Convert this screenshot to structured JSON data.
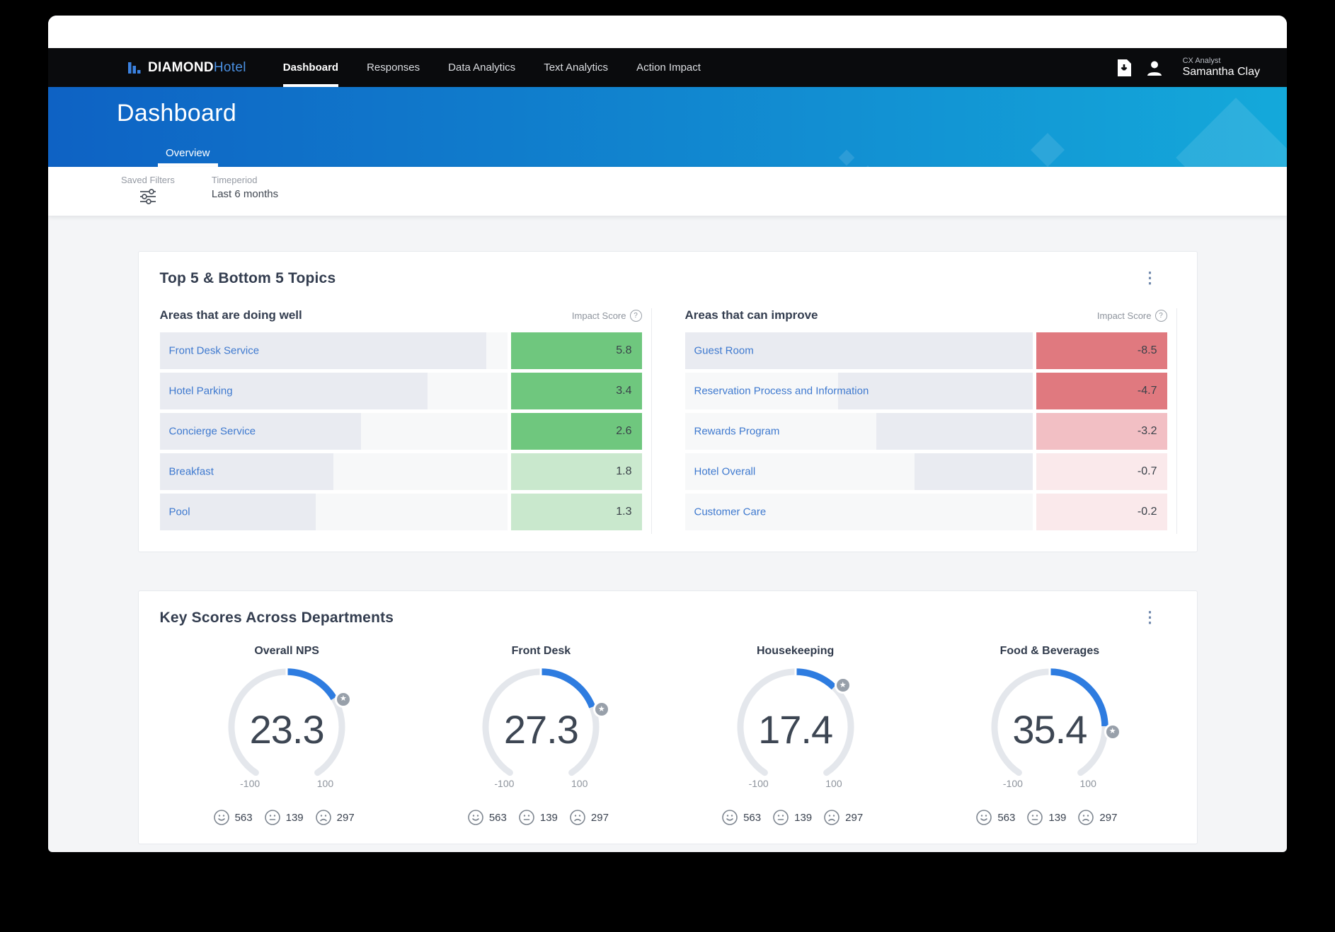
{
  "nav": {
    "brand": {
      "bold": "DIAMOND",
      "light": "Hotel"
    },
    "items": [
      {
        "label": "Dashboard",
        "active": true
      },
      {
        "label": "Responses",
        "active": false
      },
      {
        "label": "Data Analytics",
        "active": false
      },
      {
        "label": "Text Analytics",
        "active": false
      },
      {
        "label": "Action Impact",
        "active": false
      }
    ],
    "user_role": "CX Analyst",
    "user_name": "Samantha Clay"
  },
  "hero": {
    "title": "Dashboard",
    "tab": "Overview"
  },
  "filter_bar": {
    "saved_filters_label": "Saved Filters",
    "timeperiod_label": "Timeperiod",
    "timeperiod_value": "Last 6 months"
  },
  "topics_card": {
    "title": "Top 5 & Bottom 5 Topics",
    "impact_score_label": "Impact Score",
    "doing_well": {
      "heading": "Areas that are doing well",
      "rows": [
        {
          "label": "Front Desk Service",
          "score": "5.8",
          "bar_percent": 94,
          "tone": "green_strong"
        },
        {
          "label": "Hotel Parking",
          "score": "3.4",
          "bar_percent": 77,
          "tone": "green_strong"
        },
        {
          "label": "Concierge Service",
          "score": "2.6",
          "bar_percent": 58,
          "tone": "green_strong"
        },
        {
          "label": "Breakfast",
          "score": "1.8",
          "bar_percent": 50,
          "tone": "green_light"
        },
        {
          "label": "Pool",
          "score": "1.3",
          "bar_percent": 45,
          "tone": "green_light"
        }
      ]
    },
    "can_improve": {
      "heading": "Areas that can improve",
      "rows": [
        {
          "label": "Guest Room",
          "score": "-8.5",
          "bar_percent": 100,
          "tone": "red_strong"
        },
        {
          "label": "Reservation Process and Information",
          "score": "-4.7",
          "bar_percent": 56,
          "tone": "red_strong"
        },
        {
          "label": "Rewards Program",
          "score": "-3.2",
          "bar_percent": 45,
          "tone": "red_mid"
        },
        {
          "label": "Hotel Overall",
          "score": "-0.7",
          "bar_percent": 34,
          "tone": "red_light"
        },
        {
          "label": "Customer Care",
          "score": "-0.2",
          "bar_percent": 0,
          "tone": "red_light"
        }
      ]
    }
  },
  "scores_card": {
    "title": "Key Scores Across Departments",
    "range_min": "-100",
    "range_max": "100",
    "gauges": [
      {
        "label": "Overall NPS",
        "value": 23.3,
        "display": "23.3"
      },
      {
        "label": "Front Desk",
        "value": 27.3,
        "display": "27.3"
      },
      {
        "label": "Housekeeping",
        "value": 17.4,
        "display": "17.4"
      },
      {
        "label": "Food & Beverages",
        "value": 35.4,
        "display": "35.4"
      }
    ],
    "sentiment": {
      "positive": "563",
      "neutral": "139",
      "negative": "297"
    }
  },
  "icons": {
    "star": "★",
    "kebab": "⋮",
    "help": "?"
  },
  "colors": {
    "accent_blue": "#2e7ce0",
    "gauge_track": "#e4e7ec",
    "hero_gradient_left": "#0e62c4",
    "hero_gradient_right": "#14a9da",
    "score_tones": {
      "green_strong": "#6fc77e",
      "green_light": "#c9e8cd",
      "red_strong": "#e0797f",
      "red_mid": "#f2bfc4",
      "red_light": "#fae9eb"
    }
  }
}
